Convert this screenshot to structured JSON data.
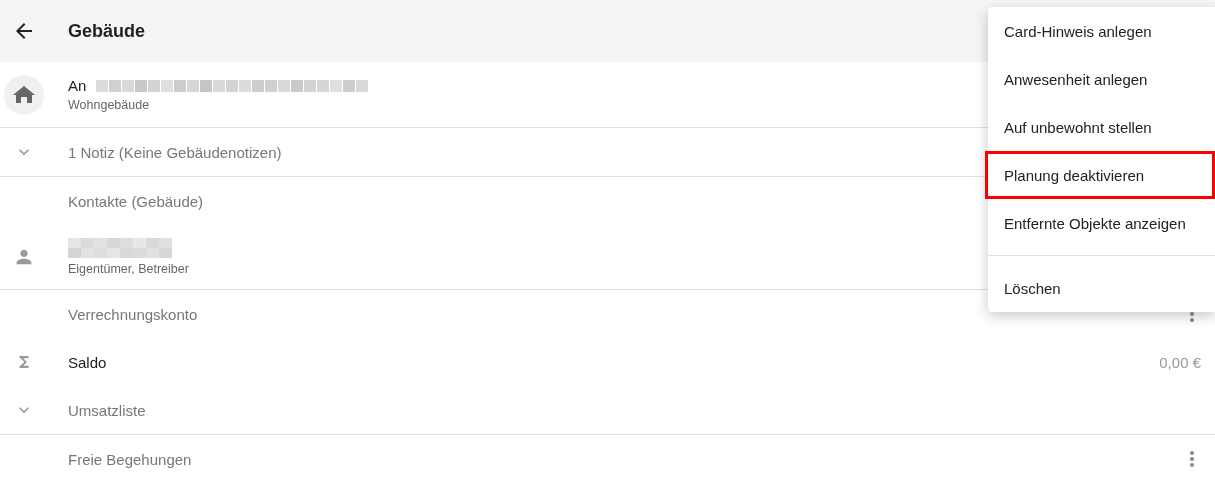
{
  "header": {
    "title": "Gebäude"
  },
  "building": {
    "title": "An",
    "subtitle": "Wohngebäude"
  },
  "notes": {
    "label": "1 Notiz (Keine Gebäudenotizen)",
    "expanded": false
  },
  "contacts": {
    "heading": "Kontakte (Gebäude)",
    "items": [
      {
        "subtitle": "Eigentümer, Betreiber"
      }
    ]
  },
  "account": {
    "heading": "Verrechnungskonto",
    "rows": [
      {
        "kind": "sum",
        "label": "Saldo",
        "value": "0,00 €"
      },
      {
        "kind": "expand",
        "label": "Umsatzliste",
        "expanded": false
      }
    ]
  },
  "inspections": {
    "heading": "Freie Begehungen"
  },
  "menu": {
    "items": [
      {
        "label": "Card-Hinweis anlegen",
        "highlighted": false
      },
      {
        "label": "Anwesenheit anlegen",
        "highlighted": false
      },
      {
        "label": "Auf unbewohnt stellen",
        "highlighted": false
      },
      {
        "label": "Planung deaktivieren",
        "highlighted": true
      },
      {
        "label": "Entfernte Objekte anzeigen",
        "highlighted": false
      },
      {
        "label": "Löschen",
        "highlighted": false,
        "divider_before": true
      }
    ]
  }
}
